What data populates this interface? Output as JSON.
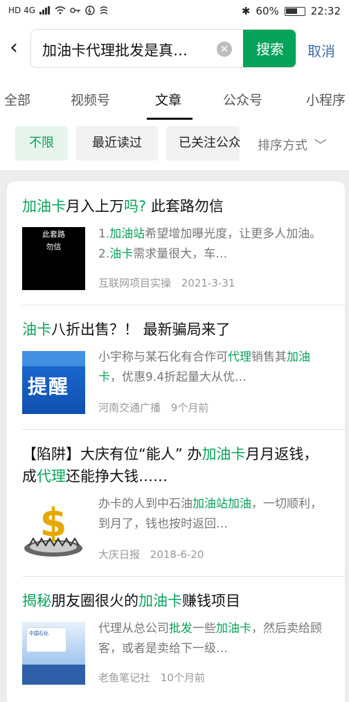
{
  "status_bar": {
    "left_icons": [
      "HD",
      "4G",
      "signal-icon",
      "wifi-icon",
      "key-icon",
      "vpn-icon",
      "app-icon"
    ],
    "network": "HD 4G",
    "bluetooth_icon": "bluetooth-icon",
    "battery_percent": "60%",
    "time": "22:32"
  },
  "search": {
    "query": "加油卡代理批发是真…",
    "search_label": "搜索",
    "cancel_label": "取消"
  },
  "tabs": [
    {
      "label": "全部"
    },
    {
      "label": "视频号"
    },
    {
      "label": "文章"
    },
    {
      "label": "公众号"
    },
    {
      "label": "小程序"
    }
  ],
  "active_tab": "文章",
  "filters": {
    "chips": [
      {
        "label": "不限"
      },
      {
        "label": "最近读过"
      },
      {
        "label": "已关注公众号"
      }
    ],
    "active_chip": "不限",
    "sort_label": "排序方式"
  },
  "articles": [
    {
      "title_parts": [
        {
          "text": "加油卡",
          "hl": true
        },
        {
          "text": "月入上万",
          "hl": false
        },
        {
          "text": "吗?",
          "hl": true
        },
        {
          "text": " 此套路勿信",
          "hl": false
        }
      ],
      "thumb_text": [
        "此套路",
        "勿信"
      ],
      "excerpt_parts": [
        {
          "text": "1.",
          "hl": false
        },
        {
          "text": "加油站",
          "hl": true
        },
        {
          "text": "希望增加曝光度，让更多人加油。2.",
          "hl": false
        },
        {
          "text": "油卡",
          "hl": true
        },
        {
          "text": "需求量很大，车…",
          "hl": false
        }
      ],
      "source": "互联网项目实操",
      "date": "2021-3-31"
    },
    {
      "title_parts": [
        {
          "text": "油卡",
          "hl": true
        },
        {
          "text": "八折出售？！ 最新骗局来了",
          "hl": false
        }
      ],
      "thumb_text": [
        "提醒"
      ],
      "excerpt_parts": [
        {
          "text": "小宇称与某石化有合作可",
          "hl": false
        },
        {
          "text": "代理",
          "hl": true
        },
        {
          "text": "销售其",
          "hl": false
        },
        {
          "text": "加油卡",
          "hl": true
        },
        {
          "text": "，优惠9.4折起量大从优…",
          "hl": false
        }
      ],
      "source": "河南交通广播",
      "date": "9个月前"
    },
    {
      "title_parts": [
        {
          "text": "【陷阱】大庆有位“能人” 办",
          "hl": false
        },
        {
          "text": "加油卡",
          "hl": true
        },
        {
          "text": "月月返钱，成",
          "hl": false
        },
        {
          "text": "代理",
          "hl": true
        },
        {
          "text": "还能挣大钱……",
          "hl": false
        }
      ],
      "thumb_text": [],
      "excerpt_parts": [
        {
          "text": "办卡的人到中石油",
          "hl": false
        },
        {
          "text": "加油站加油",
          "hl": true
        },
        {
          "text": "，一切顺利，到月了，钱也按时返回…",
          "hl": false
        }
      ],
      "source": "大庆日报",
      "date": "2018-6-20"
    },
    {
      "title_parts": [
        {
          "text": "揭秘",
          "hl": true
        },
        {
          "text": "朋友圈很火的",
          "hl": false
        },
        {
          "text": "加油卡",
          "hl": true
        },
        {
          "text": "赚钱项目",
          "hl": false
        }
      ],
      "thumb_text": [
        "中国石化"
      ],
      "excerpt_parts": [
        {
          "text": "代理从总公司",
          "hl": false
        },
        {
          "text": "批发",
          "hl": true
        },
        {
          "text": "一些",
          "hl": false
        },
        {
          "text": "加油卡",
          "hl": true
        },
        {
          "text": "，然后卖给顾客，或者是卖给下一级…",
          "hl": false
        }
      ],
      "source": "老鱼笔记社",
      "date": "10个月前"
    }
  ],
  "colors": {
    "accent": "#07a35a",
    "link": "#3f6aa8",
    "muted": "#999999"
  }
}
